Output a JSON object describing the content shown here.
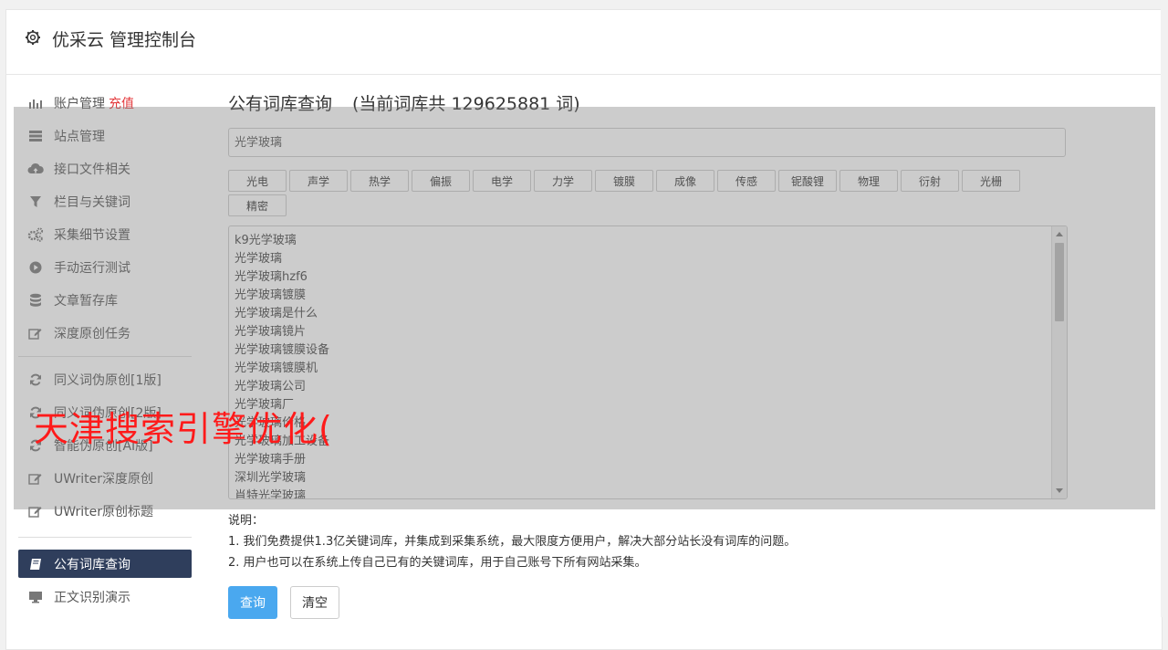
{
  "header": {
    "title": "优采云 管理控制台",
    "icon": "gear-icon"
  },
  "sidebar": {
    "group1": [
      {
        "label": "账户管理",
        "extra": "充值",
        "icon": "bar-chart-icon"
      },
      {
        "label": "站点管理",
        "icon": "server-icon"
      },
      {
        "label": "接口文件相关",
        "icon": "cloud-upload-icon"
      },
      {
        "label": "栏目与关键词",
        "icon": "filter-icon"
      },
      {
        "label": "采集细节设置",
        "icon": "gears-icon"
      },
      {
        "label": "手动运行测试",
        "icon": "play-circle-icon"
      },
      {
        "label": "文章暂存库",
        "icon": "database-icon"
      },
      {
        "label": "深度原创任务",
        "icon": "edit-icon"
      }
    ],
    "group2": [
      {
        "label": "同义词伪原创[1版]",
        "icon": "refresh-icon"
      },
      {
        "label": "同义词伪原创[2版]",
        "icon": "refresh-icon"
      },
      {
        "label": "智能伪原创[AI版]",
        "icon": "refresh-icon"
      },
      {
        "label": "UWriter深度原创",
        "icon": "edit-icon"
      },
      {
        "label": "UWriter原创标题",
        "icon": "edit-icon"
      }
    ],
    "group3": [
      {
        "label": "公有词库查询",
        "icon": "book-icon",
        "active": true
      },
      {
        "label": "正文识别演示",
        "icon": "monitor-icon"
      }
    ]
  },
  "main": {
    "title": "公有词库查询",
    "count_text": "(当前词库共 129625881 词)",
    "keyword_value": "光学玻璃",
    "tags": [
      "光电",
      "声学",
      "热学",
      "偏振",
      "电学",
      "力学",
      "镀膜",
      "成像",
      "传感",
      "铌酸锂",
      "物理",
      "衍射",
      "光栅",
      "精密"
    ],
    "results": [
      "k9光学玻璃",
      "光学玻璃",
      "光学玻璃hzf6",
      "光学玻璃镀膜",
      "光学玻璃是什么",
      "光学玻璃镜片",
      "光学玻璃镀膜设备",
      "光学玻璃镀膜机",
      "光学玻璃公司",
      "光学玻璃厂",
      "光学玻璃价格",
      "光学玻璃加工设备",
      "光学玻璃手册",
      "深圳光学玻璃",
      "肖特光学玻璃"
    ],
    "notes_title": "说明：",
    "notes": [
      "1. 我们免费提供1.3亿关键词库，并集成到采集系统，最大限度方便用户，解决大部分站长没有词库的问题。",
      "2. 用户也可以在系统上传自己已有的关键词库，用于自己账号下所有网站采集。"
    ],
    "query_button": "查询",
    "clear_button": "清空"
  },
  "watermark": "天津搜索引擎优化(",
  "colors": {
    "active_bg": "#2f3e5c",
    "primary": "#4aa8ef",
    "red": "#e4393c",
    "watermark": "#ff1a1a"
  }
}
